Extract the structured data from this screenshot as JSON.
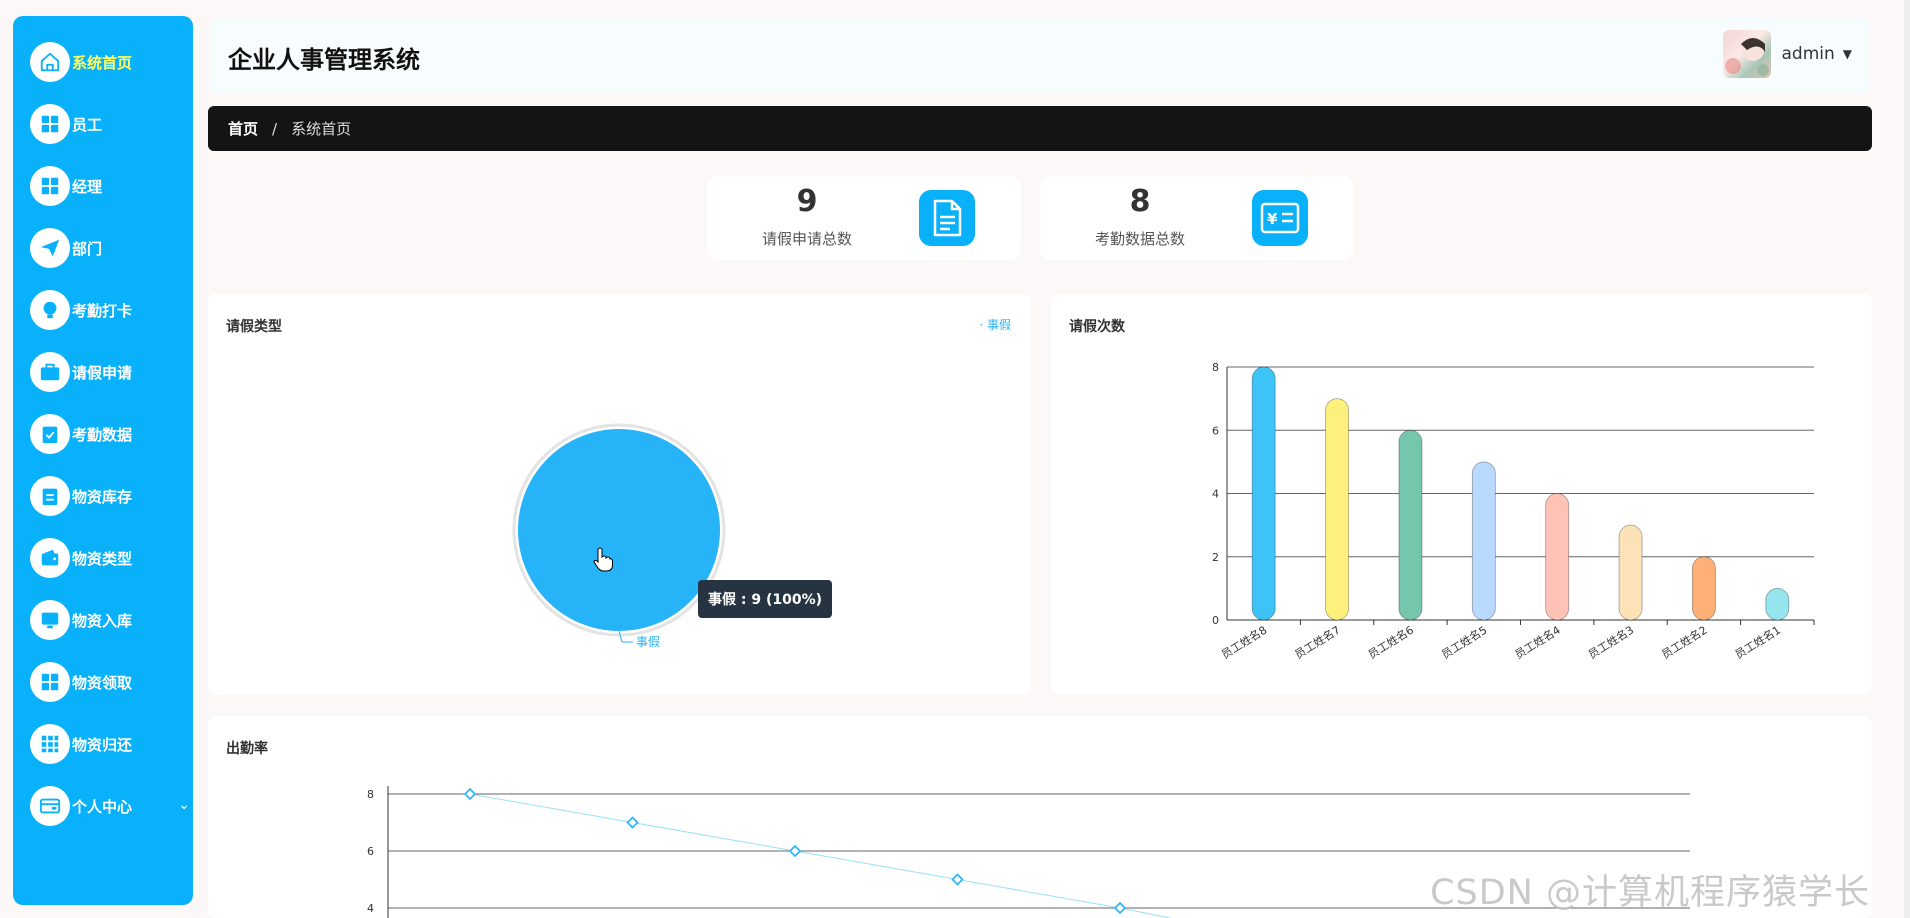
{
  "app": {
    "title": "企业人事管理系统"
  },
  "user": {
    "name": "admin",
    "caret": "▼"
  },
  "sidebar": {
    "items": [
      {
        "label": "系统首页",
        "icon": "home-icon",
        "active": true
      },
      {
        "label": "员工",
        "icon": "grid-icon"
      },
      {
        "label": "经理",
        "icon": "grid-icon"
      },
      {
        "label": "部门",
        "icon": "paper-plane-icon"
      },
      {
        "label": "考勤打卡",
        "icon": "lightbulb-icon"
      },
      {
        "label": "请假申请",
        "icon": "briefcase-icon"
      },
      {
        "label": "考勤数据",
        "icon": "clipboard-check-icon"
      },
      {
        "label": "物资库存",
        "icon": "clipboard-icon"
      },
      {
        "label": "物资类型",
        "icon": "wallet-icon"
      },
      {
        "label": "物资入库",
        "icon": "monitor-icon"
      },
      {
        "label": "物资领取",
        "icon": "grid-icon"
      },
      {
        "label": "物资归还",
        "icon": "apps-icon"
      },
      {
        "label": "个人中心",
        "icon": "card-icon",
        "chevron": "⌄"
      }
    ]
  },
  "breadcrumb": {
    "home": "首页",
    "separator": "/",
    "current": "系统首页"
  },
  "stats": [
    {
      "value": "9",
      "label": "请假申请总数",
      "icon": "document-icon"
    },
    {
      "value": "8",
      "label": "考勤数据总数",
      "icon": "yen-card-icon"
    }
  ],
  "colors": {
    "accent": "#08b1fa",
    "active_label": "#ffff66"
  },
  "leave_type": {
    "title": "请假类型",
    "legend": "· 事假",
    "slice_label": "事假",
    "tooltip": "事假 : 9 (100%)"
  },
  "leave_count": {
    "title": "请假次数"
  },
  "attendance": {
    "title": "出勤率"
  },
  "watermark": "CSDN @计算机程序猿学长",
  "chart_data": [
    {
      "type": "pie",
      "title": "请假类型",
      "labels": [
        "事假"
      ],
      "values": [
        9
      ],
      "colors": [
        "#27b3f7"
      ]
    },
    {
      "type": "bar",
      "title": "请假次数",
      "categories": [
        "员工姓名8",
        "员工姓名7",
        "员工姓名6",
        "员工姓名5",
        "员工姓名4",
        "员工姓名3",
        "员工姓名2",
        "员工姓名1"
      ],
      "values": [
        8,
        7,
        6,
        5,
        4,
        3,
        2,
        1
      ],
      "colors": [
        "#3ec3f7",
        "#fef07c",
        "#74c6ac",
        "#b9dafe",
        "#ffc2b6",
        "#fde2b8",
        "#ffb077",
        "#95e5ee"
      ],
      "ylim": [
        0,
        8
      ],
      "yticks": [
        0,
        2,
        4,
        6,
        8
      ],
      "grid": true
    },
    {
      "type": "line",
      "title": "出勤率",
      "values": [
        8,
        7,
        6,
        5,
        4
      ],
      "yticks": [
        4,
        6,
        8
      ],
      "grid": true
    }
  ]
}
